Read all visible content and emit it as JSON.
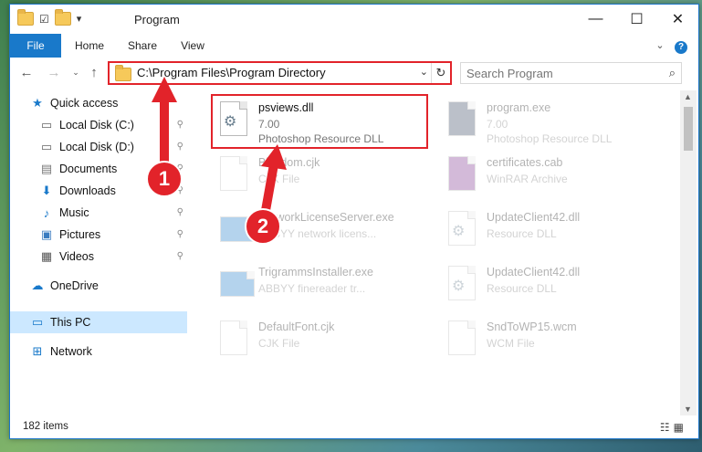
{
  "window": {
    "title": "Program",
    "controls": {
      "minimize": "—",
      "maximize": "☐",
      "close": "✕"
    }
  },
  "ribbon": {
    "tabs": [
      "File",
      "Home",
      "Share",
      "View"
    ]
  },
  "address": {
    "path": "C:\\Program Files\\Program Directory"
  },
  "search": {
    "placeholder": "Search Program"
  },
  "sidebar": {
    "items": [
      {
        "label": "Quick access",
        "icon": "star-icon"
      },
      {
        "label": "Local Disk (C:)",
        "icon": "drive-icon",
        "pinned": true
      },
      {
        "label": "Local Disk (D:)",
        "icon": "drive-icon",
        "pinned": true
      },
      {
        "label": "Documents",
        "icon": "documents-icon",
        "pinned": true
      },
      {
        "label": "Downloads",
        "icon": "download-icon",
        "pinned": true
      },
      {
        "label": "Music",
        "icon": "music-icon",
        "pinned": true
      },
      {
        "label": "Pictures",
        "icon": "pictures-icon",
        "pinned": true
      },
      {
        "label": "Videos",
        "icon": "videos-icon",
        "pinned": true
      },
      {
        "label": "OneDrive",
        "icon": "cloud-icon"
      },
      {
        "label": "This PC",
        "icon": "computer-icon",
        "selected": true
      },
      {
        "label": "Network",
        "icon": "network-icon"
      }
    ]
  },
  "files": [
    {
      "name": "psviews.dll",
      "line1": "7.00",
      "line2": "Photoshop Resource DLL",
      "highlight": true
    },
    {
      "name": "program.exe",
      "line1": "7.00",
      "line2": "Photoshop Resource DLL"
    },
    {
      "name": "Biosdom.cjk",
      "line1": "CJK File",
      "line2": ""
    },
    {
      "name": "certificates.cab",
      "line1": "WinRAR Archive",
      "line2": ""
    },
    {
      "name": "NetworkLicenseServer.exe",
      "line1": "ABBYY network licens...",
      "line2": ""
    },
    {
      "name": "UpdateClient42.dll",
      "line1": "Resource DLL",
      "line2": ""
    },
    {
      "name": "TrigrammsInstaller.exe",
      "line1": "ABBYY finereader tr...",
      "line2": ""
    },
    {
      "name": "UpdateClient42.dll",
      "line1": "Resource DLL",
      "line2": ""
    },
    {
      "name": "DefaultFont.cjk",
      "line1": "CJK File",
      "line2": ""
    },
    {
      "name": "SndToWP15.wcm",
      "line1": "WCM File",
      "line2": ""
    }
  ],
  "status": {
    "items_count": "182 items"
  },
  "annotations": {
    "badge_1": "1",
    "badge_2": "2"
  },
  "colors": {
    "accent": "#1979ca",
    "highlight_red": "#e2232a",
    "selected": "#cce8ff"
  }
}
